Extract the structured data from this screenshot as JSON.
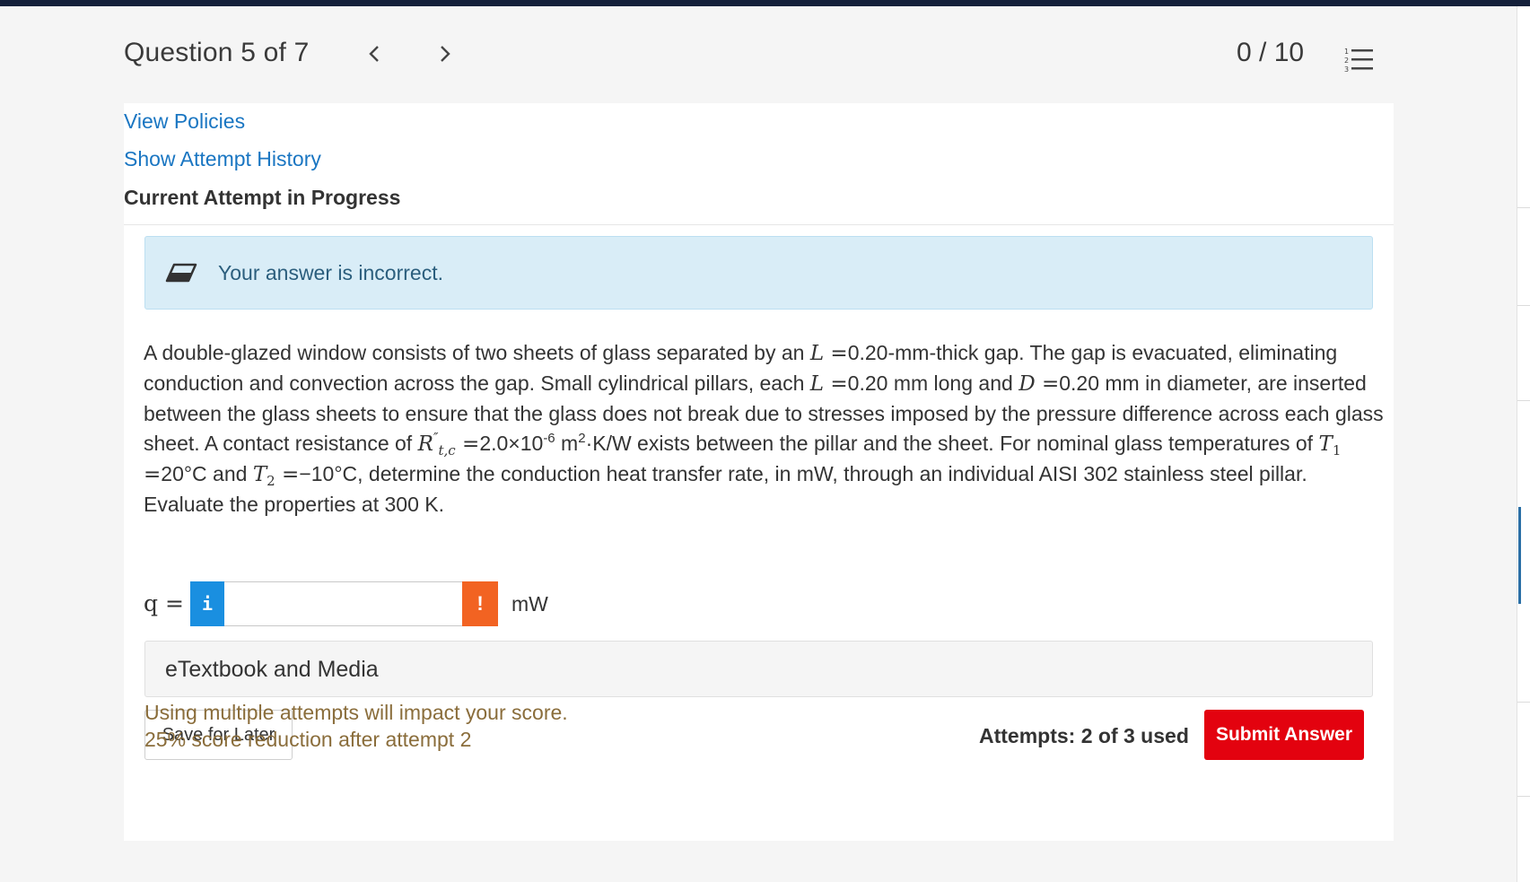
{
  "header": {
    "question_label": "Question 5 of 7",
    "score": "0 / 10"
  },
  "links": {
    "view_policies": "View Policies",
    "attempt_history": "Show Attempt History"
  },
  "current_attempt": "Current Attempt in Progress",
  "feedback": {
    "message": "Your answer is incorrect."
  },
  "question": {
    "t1": "A double-glazed window consists of two sheets of glass separated by an ",
    "L": "L",
    "eq1": " =",
    "t2": "0.20-mm-thick gap. The gap is evacuated, eliminating conduction and convection across the gap. Small cylindrical pillars, each ",
    "L2": "L",
    "eq2": " =",
    "t3": "0.20 mm long and ",
    "D": "D",
    "eq3": " =",
    "t4": "0.20 mm in diameter, are inserted between the glass sheets to ensure that the glass does not break due to stresses imposed by the pressure difference across each glass sheet. A contact resistance of ",
    "R": "R",
    "R_sup": "″",
    "R_sub": "t,c",
    "eq4": " =",
    "t5": "2.0×10",
    "exp": "-6",
    "t6": " m",
    "exp2": "2",
    "t7": "·K/W exists between the pillar and the sheet. For nominal glass temperatures of ",
    "T": "T",
    "T1_sub": "1",
    "eq5": " =",
    "t8": "20°C and ",
    "T_2": "T",
    "T2_sub": "2",
    "eq6": " =",
    "t9": "−10°C, determine the conduction heat transfer rate, in mW, through an individual AISI 302 stainless steel pillar. Evaluate the properties at 300 K."
  },
  "answer": {
    "variable": "q =",
    "info_glyph": "i",
    "warn_glyph": "!",
    "value": "",
    "unit": "mW"
  },
  "etextbook": "eTextbook and Media",
  "save_label": "Save for Later",
  "penalty": {
    "line1": "Using multiple attempts will impact your score.",
    "line2": "25% score reduction after attempt 2"
  },
  "attempts": "Attempts: 2 of 3 used",
  "submit_label": "Submit Answer"
}
